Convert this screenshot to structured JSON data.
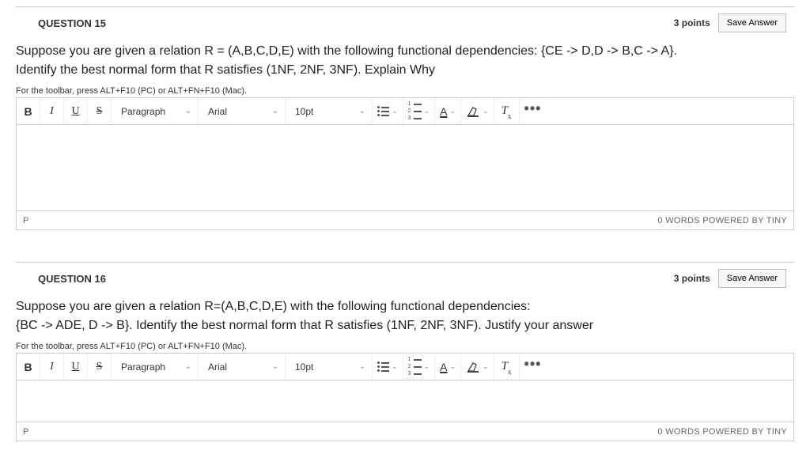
{
  "questions": [
    {
      "label": "QUESTION 15",
      "points": "3 points",
      "save": "Save Answer",
      "body": "Suppose you are given a relation R = (A,B,C,D,E) with the following functional dependencies: {CE -> D,D -> B,C -> A}.\nIdentify the best normal form that R satisfies (1NF, 2NF, 3NF). Explain Why",
      "toolbar_hint": "For the toolbar, press ALT+F10 (PC) or ALT+FN+F10 (Mac).",
      "status_path": "P",
      "status_right": "0 WORDS  POWERED BY TINY"
    },
    {
      "label": "QUESTION 16",
      "points": "3 points",
      "save": "Save Answer",
      "body": "Suppose you are given a relation R=(A,B,C,D,E) with the following functional dependencies:\n{BC -> ADE, D -> B}. Identify the best normal form that R satisfies (1NF, 2NF, 3NF). Justify your answer",
      "toolbar_hint": "For the toolbar, press ALT+F10 (PC) or ALT+FN+F10 (Mac).",
      "status_path": "P",
      "status_right": "0 WORDS  POWERED BY TINY"
    }
  ],
  "toolbar": {
    "bold": "B",
    "italic": "I",
    "underline": "U",
    "strike": "S",
    "block_format": "Paragraph",
    "font_family": "Arial",
    "font_size": "10pt",
    "text_color": "A",
    "clear_format": "T",
    "clear_format_sub": "x",
    "more": "•••"
  }
}
